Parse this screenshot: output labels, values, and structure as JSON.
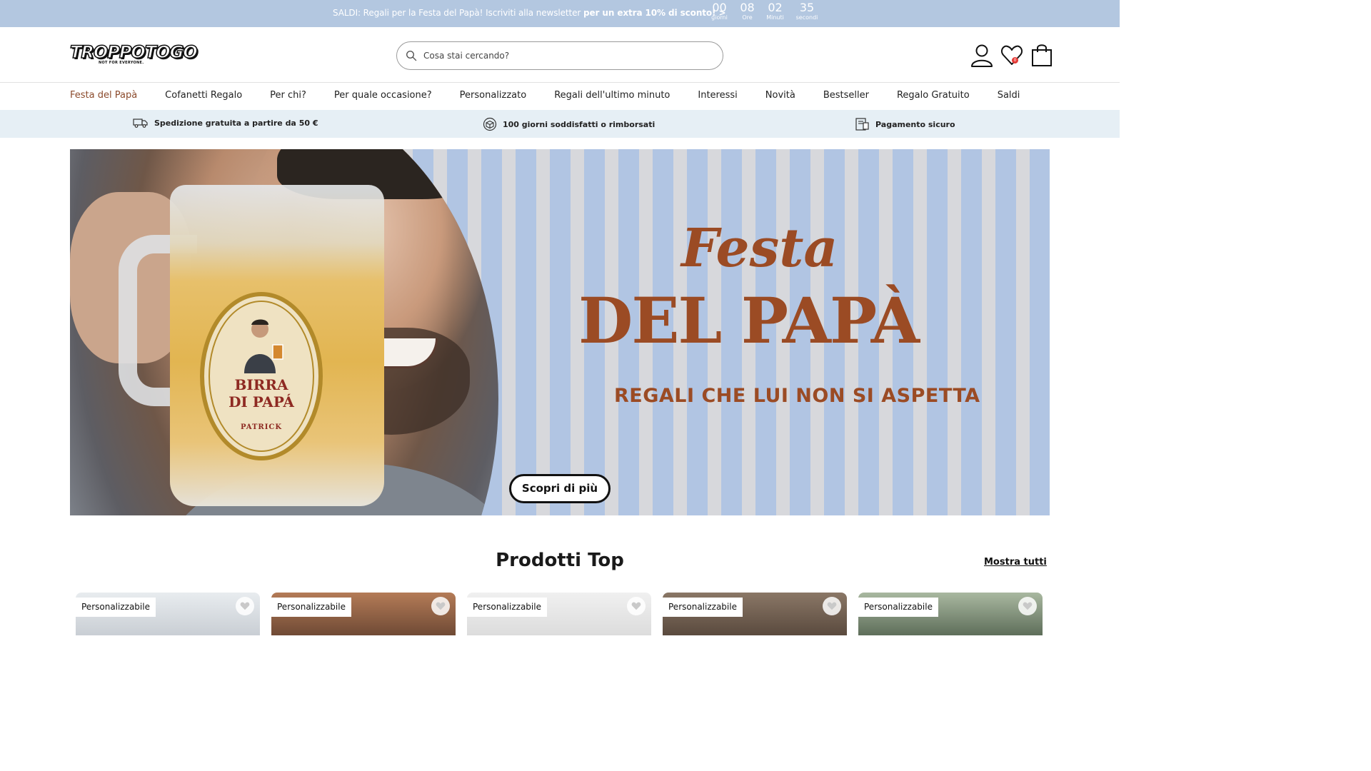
{
  "topbar": {
    "promo_text": "SALDI: Regali per la Festa del Papà! Iscriviti alla newsletter ",
    "promo_bold": "per un extra 10% di sconto! >",
    "countdown": [
      {
        "value": "00",
        "label": "giorni"
      },
      {
        "value": "08",
        "label": "Ore"
      },
      {
        "value": "02",
        "label": "Minuti"
      },
      {
        "value": "35",
        "label": "secondi"
      }
    ]
  },
  "header": {
    "logo_text": "TROPPOTOGO",
    "logo_tagline": "NOT FOR EVERYONE.",
    "search_placeholder": "Cosa stai cercando?",
    "wishlist_count": "0"
  },
  "nav": {
    "items": [
      "Festa del Papà",
      "Cofanetti Regalo",
      "Per chi?",
      "Per quale occasione?",
      "Personalizzato",
      "Regali dell'ultimo minuto",
      "Interessi",
      "Novità",
      "Bestseller",
      "Regalo Gratuito",
      "Saldi"
    ]
  },
  "usp": {
    "shipping": "Spedizione gratuita a partire da 50 €",
    "returns": "100 giorni soddisfatti o rimborsati",
    "payment": "Pagamento sicuro"
  },
  "hero": {
    "title_script": "Festa",
    "title_main": "DEL PAPÀ",
    "subtitle": "REGALI CHE LUI NON SI ASPETTA",
    "mug_label_1": "BIRRA",
    "mug_label_2": "DI PAPÁ",
    "mug_label_name": "PATRICK",
    "cta": "Scopri di più"
  },
  "products": {
    "title": "Prodotti Top",
    "show_all": "Mostra tutti",
    "cards": [
      {
        "tag": "Personalizzabile"
      },
      {
        "tag": "Personalizzabile"
      },
      {
        "tag": "Personalizzabile"
      },
      {
        "tag": "Personalizzabile"
      },
      {
        "tag": "Personalizzabile"
      }
    ]
  },
  "colors": {
    "topbar_bg": "#b3c7e0",
    "accent_brown": "#9b4b24",
    "nav_active": "#8b4a2b",
    "usp_bg": "#e6eff5",
    "badge_red": "#e53935"
  }
}
